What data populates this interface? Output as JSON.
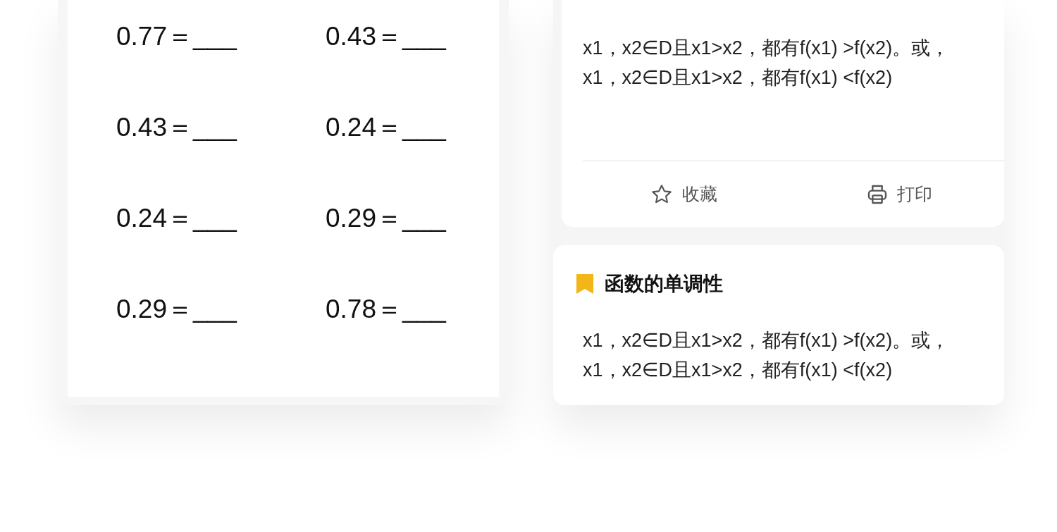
{
  "worksheet": {
    "rows": [
      {
        "left": "0.77＝___",
        "right": "0.43＝___"
      },
      {
        "left": "0.43＝___",
        "right": "0.24＝___"
      },
      {
        "left": "0.24＝___",
        "right": "0.29＝___"
      },
      {
        "left": "0.29＝___",
        "right": "0.78＝___"
      }
    ]
  },
  "notes": [
    {
      "lines": [
        "x1，x2∈D且x1>x2，都有f(x1) >f(x2)。或，",
        "x1，x2∈D且x1>x2，都有f(x1) <f(x2)"
      ],
      "actions": [
        {
          "kind": "favorite",
          "label": "收藏"
        },
        {
          "kind": "print",
          "label": "打印"
        }
      ]
    },
    {
      "title": "函数的单调性",
      "lines": [
        "x1，x2∈D且x1>x2，都有f(x1) >f(x2)。或，",
        "x1，x2∈D且x1>x2，都有f(x1) <f(x2)"
      ]
    }
  ]
}
